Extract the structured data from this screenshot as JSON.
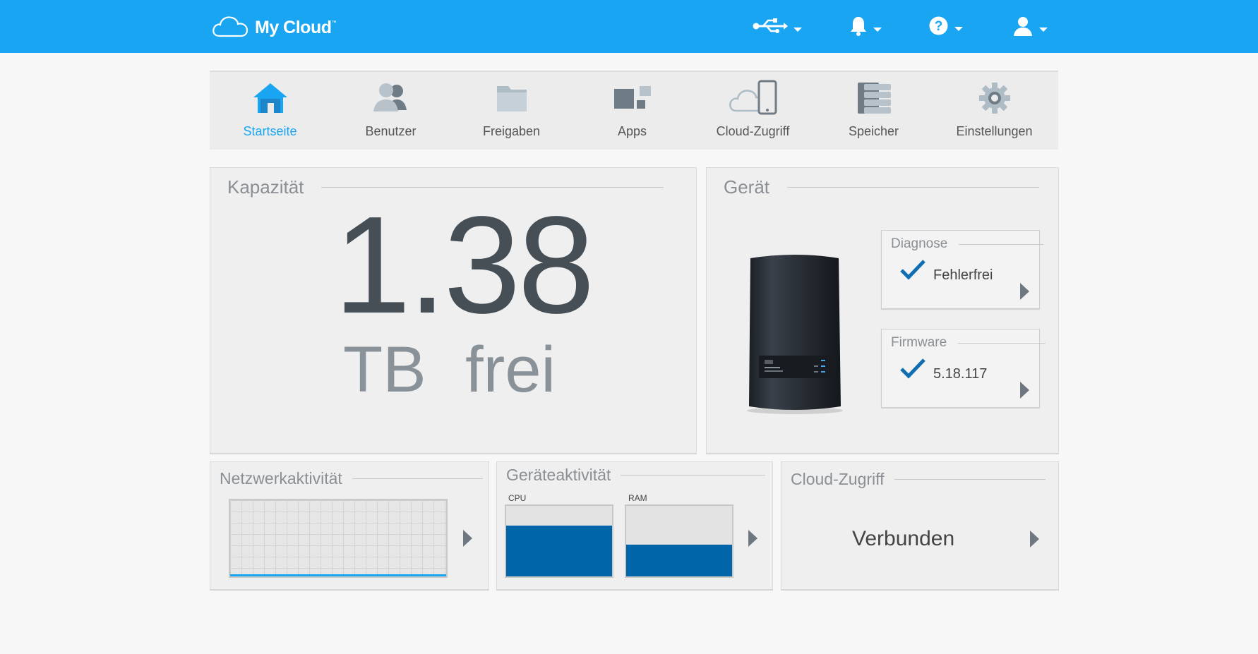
{
  "header": {
    "logo_text": "My Cloud",
    "logo_tm": "™",
    "icons": [
      "usb-icon",
      "bell-icon",
      "help-icon",
      "user-icon"
    ],
    "accent_color": "#1aa5f2"
  },
  "nav": {
    "items": [
      {
        "label": "Startseite",
        "icon": "home-icon",
        "active": true
      },
      {
        "label": "Benutzer",
        "icon": "users-icon"
      },
      {
        "label": "Freigaben",
        "icon": "folder-icon"
      },
      {
        "label": "Apps",
        "icon": "apps-icon"
      },
      {
        "label": "Cloud-Zugriff",
        "icon": "cloud-device-icon"
      },
      {
        "label": "Speicher",
        "icon": "storage-icon"
      },
      {
        "label": "Einstellungen",
        "icon": "gear-icon"
      }
    ]
  },
  "capacity": {
    "title": "Kapazität",
    "value": "1.38",
    "unit_text": "TB frei"
  },
  "device": {
    "title": "Gerät",
    "diagnose": {
      "title": "Diagnose",
      "value": "Fehlerfrei"
    },
    "firmware": {
      "title": "Firmware",
      "value": "5.18.117"
    }
  },
  "network": {
    "title": "Netzwerkaktivität"
  },
  "activity": {
    "title": "Geräteaktivität",
    "cpu_label": "CPU",
    "ram_label": "RAM",
    "cpu_fraction": 0.72,
    "ram_fraction": 0.45
  },
  "cloud": {
    "title": "Cloud-Zugriff",
    "status": "Verbunden"
  },
  "colors": {
    "accent": "#1aa5f2",
    "meter_fill": "#0065a9",
    "check": "#0f6db2"
  }
}
